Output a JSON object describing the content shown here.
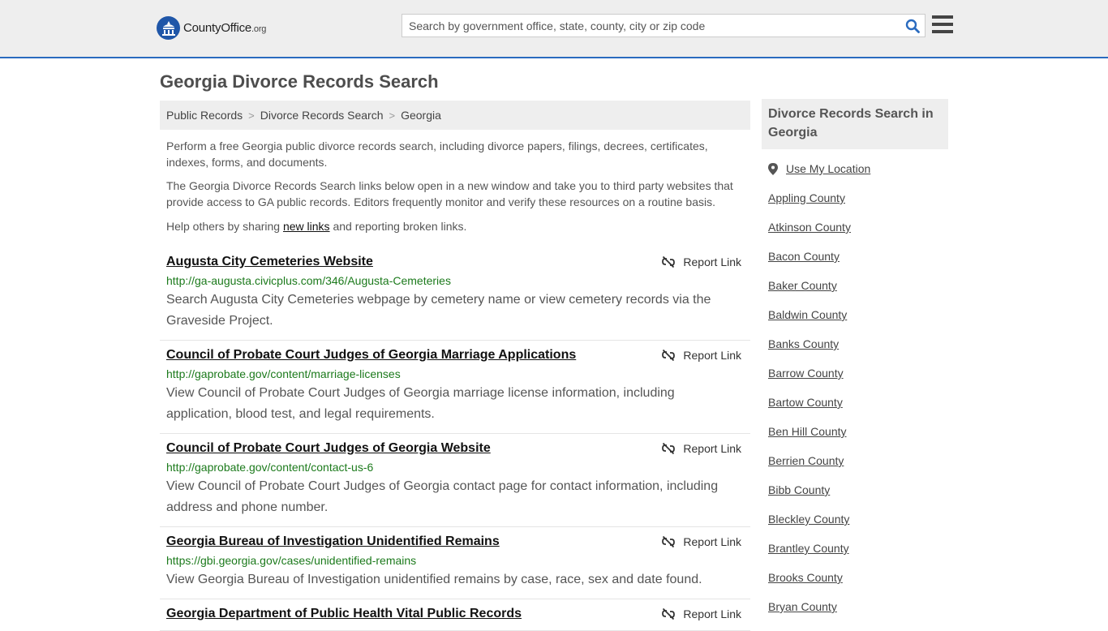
{
  "header": {
    "logo": {
      "name": "County",
      "name_bold": "Office",
      "suffix": ".org"
    },
    "search": {
      "placeholder": "Search by government office, state, county, city or zip code"
    }
  },
  "page_title": "Georgia Divorce Records Search",
  "breadcrumb": [
    "Public Records",
    "Divorce Records Search",
    "Georgia"
  ],
  "breadcrumb_sep": ">",
  "intro": {
    "p1": "Perform a free Georgia public divorce records search, including divorce papers, filings, decrees, certificates, indexes, forms, and documents.",
    "p2": "The Georgia Divorce Records Search links below open in a new window and take you to third party websites that provide access to GA public records. Editors frequently monitor and verify these resources on a routine basis.",
    "p3_before": "Help others by sharing ",
    "p3_link": "new links",
    "p3_after": " and reporting broken links."
  },
  "report_label": "Report Link",
  "results": [
    {
      "title": "Augusta City Cemeteries Website",
      "url": "http://ga-augusta.civicplus.com/346/Augusta-Cemeteries",
      "desc": "Search Augusta City Cemeteries webpage by cemetery name or view cemetery records via the Graveside Project."
    },
    {
      "title": "Council of Probate Court Judges of Georgia Marriage Applications",
      "url": "http://gaprobate.gov/content/marriage-licenses",
      "desc": "View Council of Probate Court Judges of Georgia marriage license information, including application, blood test, and legal requirements."
    },
    {
      "title": "Council of Probate Court Judges of Georgia Website",
      "url": "http://gaprobate.gov/content/contact-us-6",
      "desc": "View Council of Probate Court Judges of Georgia contact page for contact information, including address and phone number."
    },
    {
      "title": "Georgia Bureau of Investigation Unidentified Remains",
      "url": "https://gbi.georgia.gov/cases/unidentified-remains",
      "desc": "View Georgia Bureau of Investigation unidentified remains by case, race, sex and date found."
    },
    {
      "title": "Georgia Department of Public Health Vital Public Records",
      "url": "",
      "desc": ""
    }
  ],
  "sidebar": {
    "title": "Divorce Records Search in Georgia",
    "use_location": "Use My Location",
    "counties": [
      "Appling County",
      "Atkinson County",
      "Bacon County",
      "Baker County",
      "Baldwin County",
      "Banks County",
      "Barrow County",
      "Bartow County",
      "Ben Hill County",
      "Berrien County",
      "Bibb County",
      "Bleckley County",
      "Brantley County",
      "Brooks County",
      "Bryan County"
    ]
  },
  "colors": {
    "accent": "#2a6bbf",
    "url_green": "#1c7a1c",
    "header_bg": "#eeeeee"
  }
}
